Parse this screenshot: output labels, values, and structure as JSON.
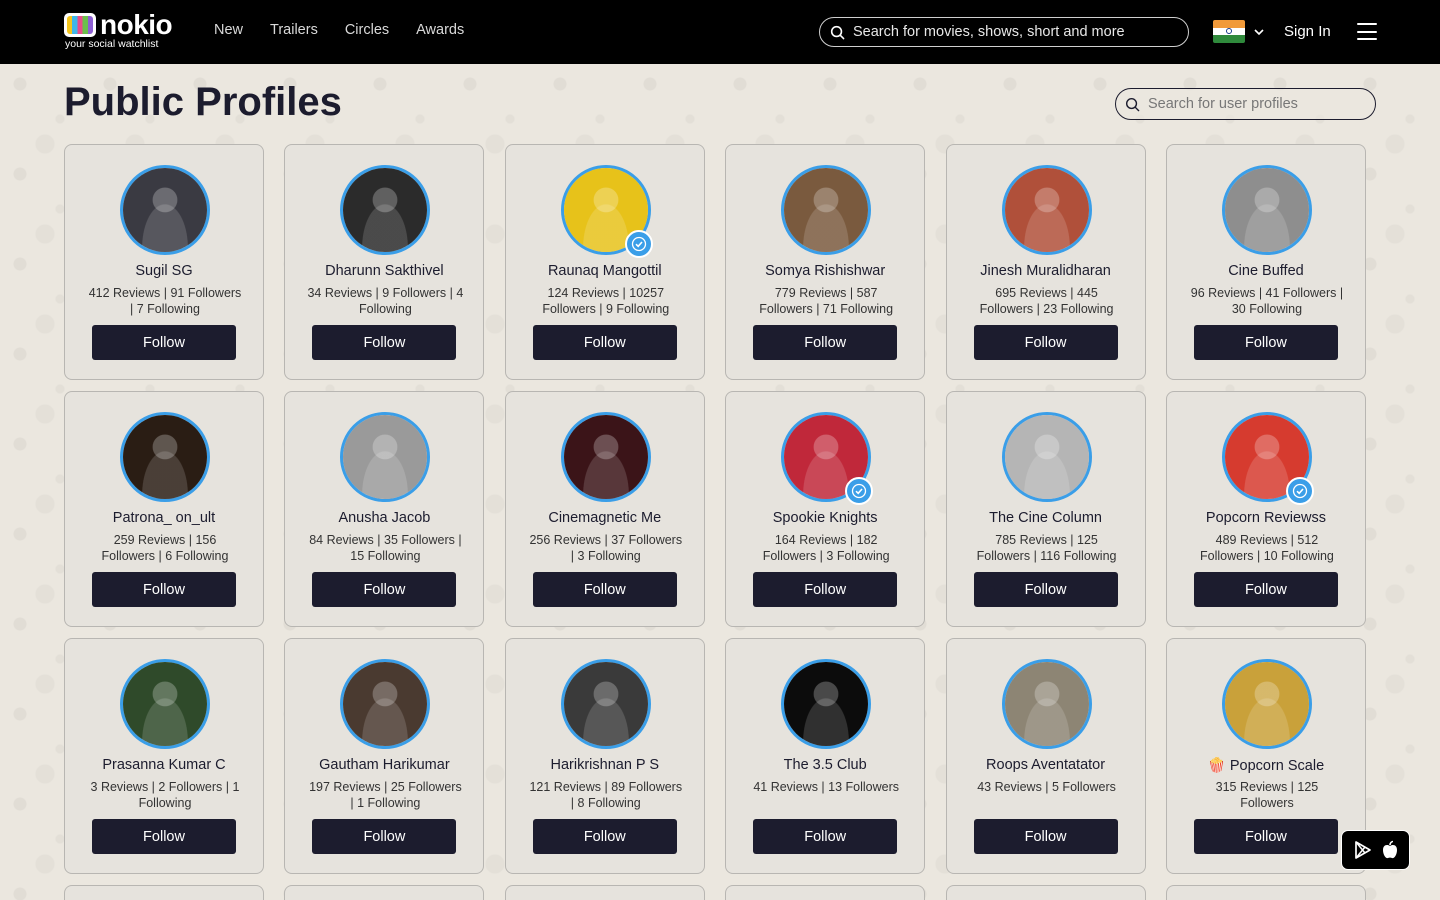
{
  "header": {
    "logo_word": "nokio",
    "logo_tagline": "your social watchlist",
    "nav": [
      "New",
      "Trailers",
      "Circles",
      "Awards"
    ],
    "search_placeholder": "Search for movies, shows, short and more",
    "sign_in": "Sign In"
  },
  "page": {
    "title": "Public Profiles",
    "search_placeholder": "Search for user profiles"
  },
  "follow_label": "Follow",
  "profiles": [
    {
      "name": "Sugil SG",
      "stats": "412 Reviews | 91 Followers | 7 Following",
      "verified": false,
      "avatar": "#3a3a42"
    },
    {
      "name": "Dharunn Sakthivel",
      "stats": "34 Reviews | 9 Followers | 4 Following",
      "verified": false,
      "avatar": "#2b2b2b"
    },
    {
      "name": "Raunaq Mangottil",
      "stats": "124 Reviews | 10257 Followers | 9 Following",
      "verified": true,
      "avatar": "#e7c21a"
    },
    {
      "name": "Somya Rishishwar",
      "stats": "779 Reviews | 587 Followers | 71 Following",
      "verified": false,
      "avatar": "#7a5a3e"
    },
    {
      "name": "Jinesh Muralidharan",
      "stats": "695 Reviews | 445 Followers | 23 Following",
      "verified": false,
      "avatar": "#b0503a"
    },
    {
      "name": "Cine Buffed",
      "stats": "96 Reviews | 41 Followers | 30 Following",
      "verified": false,
      "avatar": "#8e8e8e"
    },
    {
      "name": "Patrona_ on_ult",
      "stats": "259 Reviews | 156 Followers | 6 Following",
      "verified": false,
      "avatar": "#2a1d14"
    },
    {
      "name": "Anusha Jacob",
      "stats": "84 Reviews | 35 Followers | 15 Following",
      "verified": false,
      "avatar": "#9a9a9a"
    },
    {
      "name": "Cinemagnetic Me",
      "stats": "256 Reviews | 37 Followers | 3 Following",
      "verified": false,
      "avatar": "#3b1418"
    },
    {
      "name": "Spookie Knights",
      "stats": "164 Reviews | 182 Followers | 3 Following",
      "verified": true,
      "avatar": "#c0283a"
    },
    {
      "name": "The Cine Column",
      "stats": "785 Reviews | 125 Followers | 116 Following",
      "verified": false,
      "avatar": "#b5b5b5"
    },
    {
      "name": "Popcorn Reviewss",
      "stats": "489 Reviews | 512 Followers | 10 Following",
      "verified": true,
      "avatar": "#d63b2f"
    },
    {
      "name": "Prasanna Kumar C",
      "stats": "3 Reviews | 2 Followers | 1 Following",
      "verified": false,
      "avatar": "#2f4a2a"
    },
    {
      "name": "Gautham Harikumar",
      "stats": "197 Reviews | 25 Followers | 1 Following",
      "verified": false,
      "avatar": "#4a3a30"
    },
    {
      "name": "Harikrishnan P S",
      "stats": "121 Reviews | 89 Followers | 8 Following",
      "verified": false,
      "avatar": "#3a3a3a"
    },
    {
      "name": "The 3.5 Club",
      "stats": "41 Reviews | 13 Followers",
      "verified": false,
      "avatar": "#0c0c0c"
    },
    {
      "name": "Roops Aventatator",
      "stats": "43 Reviews | 5 Followers",
      "verified": false,
      "avatar": "#8d8574"
    },
    {
      "name": "🍿 Popcorn Scale",
      "stats": "315 Reviews | 125 Followers",
      "verified": false,
      "avatar": "#c9a13a"
    }
  ]
}
